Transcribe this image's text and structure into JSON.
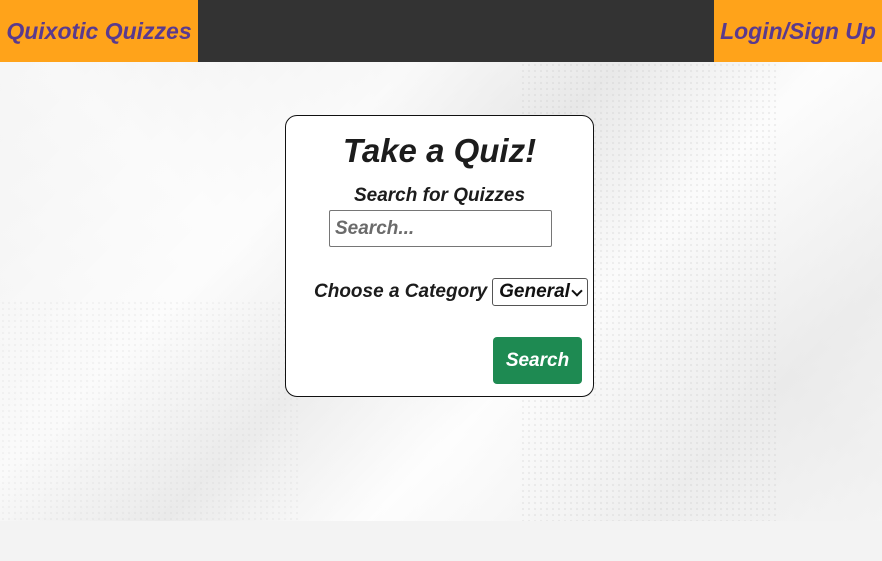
{
  "header": {
    "brand": "Quixotic Quizzes",
    "login": "Login/Sign Up"
  },
  "card": {
    "title": "Take a Quiz!",
    "search_label": "Search for Quizzes",
    "search_placeholder": "Search...",
    "search_value": "",
    "category_label": "Choose a Category",
    "category_selected": "General",
    "search_button": "Search"
  },
  "colors": {
    "header_bg": "#333333",
    "accent_orange": "#ffa31a",
    "brand_text": "#5a3a8e",
    "button_green": "#1e8a52"
  },
  "icons": {
    "select_chevron": "chevron-down-icon"
  }
}
